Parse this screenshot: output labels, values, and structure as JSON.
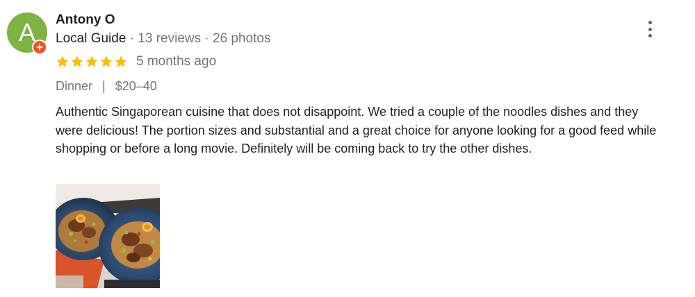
{
  "review": {
    "avatar_letter": "A",
    "author_name": "Antony O",
    "author_role": "Local Guide",
    "reviews_count": "13 reviews",
    "photos_count": "26 photos",
    "meta_separator": "·",
    "rating": 5,
    "rating_max": 5,
    "time_ago": "5 months ago",
    "meal_type": "Dinner",
    "price_range": "$20–40",
    "tag_separator": "|",
    "text": "Authentic Singaporean cuisine that does not disappoint. We tried a couple of the noodles dishes and they were delicious! The portion sizes and substantial and a great choice for anyone looking for a good feed while shopping or before a long movie. Definitely will be coming back to try the other dishes."
  },
  "icons": {
    "avatar_badge": "local-guide-badge-icon",
    "star": "star-icon",
    "more": "more-vert-icon"
  },
  "colors": {
    "avatar_bg": "#7cb342",
    "badge": "#f4511e",
    "star": "#fbbc04",
    "secondary_text": "#70757a"
  }
}
